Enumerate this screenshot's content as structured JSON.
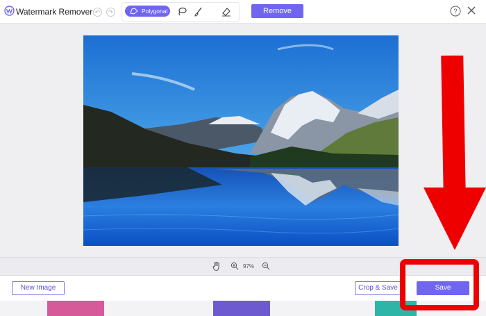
{
  "header": {
    "app_title": "Watermark Remover",
    "tools": {
      "polygon_label": "Polygonal",
      "lasso_icon": "lasso-icon",
      "brush_icon": "brush-icon",
      "eraser_icon": "eraser-icon"
    },
    "remove_label": "Remove",
    "help_icon": "help-icon",
    "close_icon": "close-icon"
  },
  "canvas": {
    "image_description_icon": "mountain-lake-photo"
  },
  "zoom": {
    "level": "97%"
  },
  "footer": {
    "new_image_label": "New Image",
    "crop_save_label": "Crop & Save",
    "save_label": "Save"
  },
  "colors": {
    "accent": "#6f65f0",
    "annotation_red": "#ee0000"
  }
}
